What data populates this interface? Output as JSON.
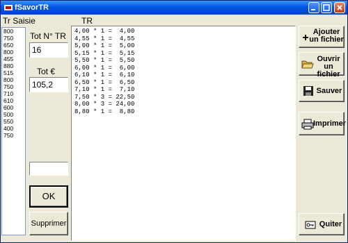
{
  "window": {
    "title": "fSavorTR"
  },
  "labels": {
    "tr_saisie": "Tr Saisie",
    "tr": "TR",
    "tot_ntr": "Tot N° TR",
    "tot_eur": "Tot €"
  },
  "saisie_values": [
    "800",
    "750",
    "650",
    "800",
    "455",
    "880",
    "515",
    "800",
    "750",
    "710",
    "610",
    "600",
    "500",
    "550",
    "400",
    "750"
  ],
  "fields": {
    "tot_ntr": "16",
    "tot_eur": "105,2",
    "input": ""
  },
  "tr_rows": [
    "4,00 * 1 =  4,00",
    "4,55 * 1 =  4,55",
    "5,00 * 1 =  5,00",
    "5,15 * 1 =  5,15",
    "5,50 * 1 =  5,50",
    "6,00 * 1 =  6,00",
    "6,10 * 1 =  6,10",
    "6,50 * 1 =  6,50",
    "7,10 * 1 =  7,10",
    "7,50 * 3 = 22,50",
    "8,00 * 3 = 24,00",
    "8,80 * 1 =  8,80"
  ],
  "buttons": {
    "ajouter": "Ajouter un fichier",
    "ouvrir": "Ouvrir un fichier",
    "sauver": "Sauver",
    "imprimer": "Imprimer",
    "quitter": "Quiter",
    "ok": "OK",
    "supprimer": "Supprimer"
  }
}
